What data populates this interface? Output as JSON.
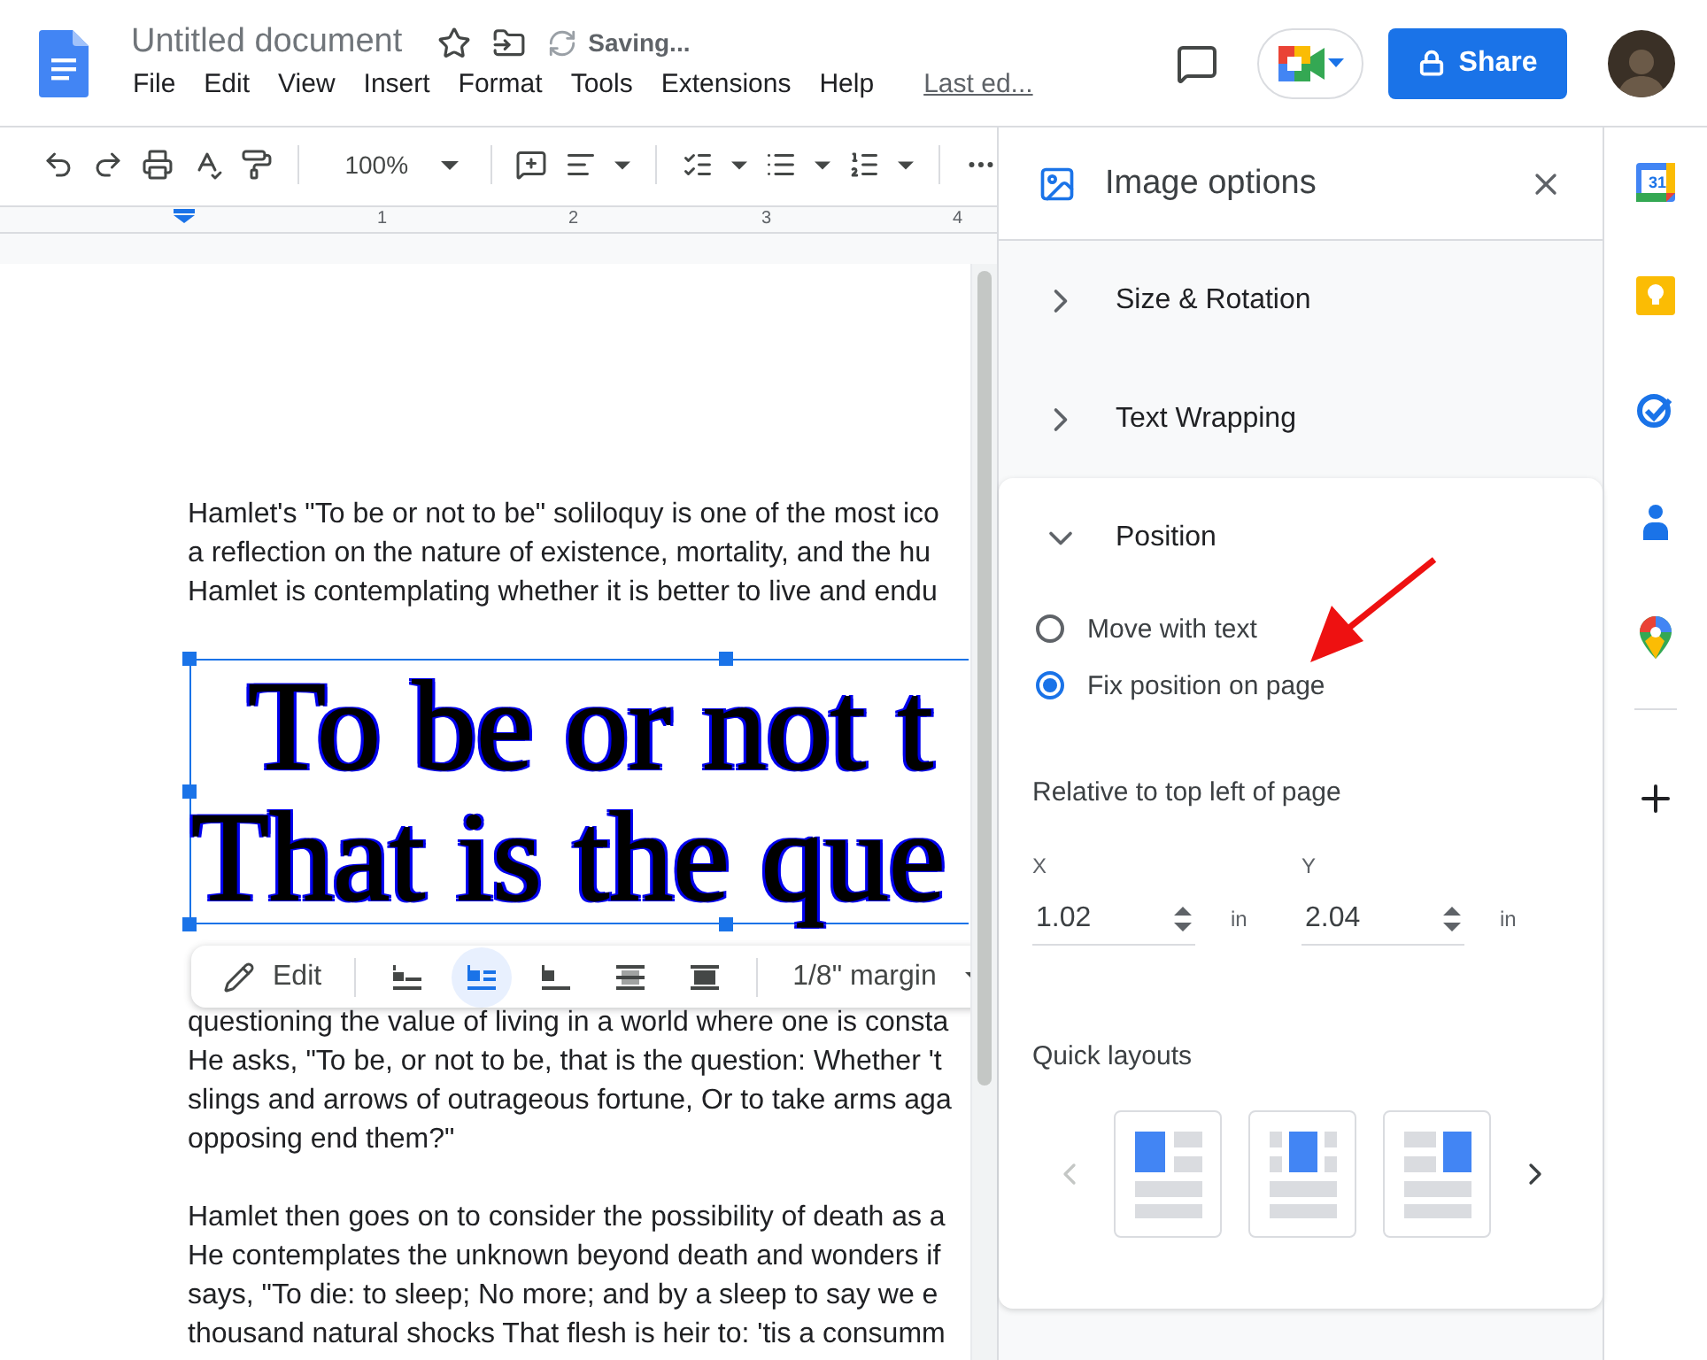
{
  "header": {
    "title": "Untitled document",
    "status": "Saving...",
    "menu": [
      "File",
      "Edit",
      "View",
      "Insert",
      "Format",
      "Tools",
      "Extensions",
      "Help"
    ],
    "last_edit": "Last ed...",
    "share": "Share"
  },
  "toolbar": {
    "zoom": "100%"
  },
  "rail": {
    "calendar_day": "31"
  },
  "ruler": {
    "marks": [
      "1",
      "2",
      "3",
      "4"
    ]
  },
  "document": {
    "paragraph_1": [
      "Hamlet's \"To be or not to be\" soliloquy is one of the most ico",
      "a reflection on the nature of existence, mortality, and the hu",
      "Hamlet is contemplating whether it is better to live and endu"
    ],
    "image": {
      "selected": true,
      "lines": [
        "To be or not t",
        "That is the que"
      ]
    },
    "paragraph_2": [
      "questioning the value of living in a world where one is consta",
      "He asks, \"To be, or not to be, that is the question: Whether 't",
      "slings and arrows of outrageous fortune, Or to take arms aga",
      "opposing end them?\""
    ],
    "paragraph_3": [
      "Hamlet then goes on to consider the possibility of death as a",
      "He contemplates the unknown beyond death and wonders if",
      "says, \"To die: to sleep; No more; and by a sleep to say we e",
      "thousand natural shocks That flesh is heir to: 'tis a consumm"
    ]
  },
  "image_toolbar": {
    "edit": "Edit",
    "wrap_options": [
      {
        "kind": "inline",
        "selected": false
      },
      {
        "kind": "wrap",
        "selected": true
      },
      {
        "kind": "break",
        "selected": false
      },
      {
        "kind": "behind",
        "selected": false
      },
      {
        "kind": "front",
        "selected": false
      }
    ],
    "margin": "1/8\" margin"
  },
  "panel": {
    "title": "Image options",
    "sections": [
      {
        "title": "Size & Rotation",
        "expanded": false
      },
      {
        "title": "Text Wrapping",
        "expanded": false
      },
      {
        "title": "Position",
        "expanded": true
      }
    ],
    "position": {
      "options": [
        {
          "label": "Move with text",
          "selected": false
        },
        {
          "label": "Fix position on page",
          "selected": true
        }
      ],
      "relative_label": "Relative to top left of page",
      "fields": [
        {
          "label": "X",
          "value": "1.02",
          "unit": "in"
        },
        {
          "label": "Y",
          "value": "2.04",
          "unit": "in"
        }
      ],
      "quick_layouts": {
        "title": "Quick layouts",
        "back_enabled": false,
        "layouts": [
          {
            "kind": "left"
          },
          {
            "kind": "center"
          },
          {
            "kind": "right"
          }
        ]
      }
    }
  }
}
